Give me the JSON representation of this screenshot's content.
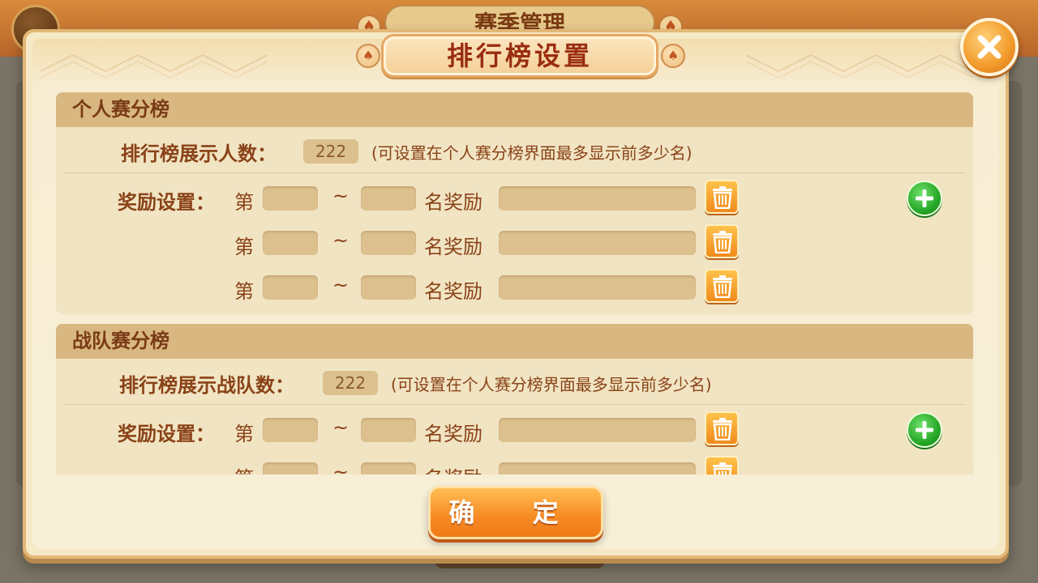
{
  "background": {
    "title": "赛季管理"
  },
  "dialog": {
    "title": "排行榜设置",
    "confirm_label": "确 定"
  },
  "personal": {
    "header": "个人赛分榜",
    "count_label": "排行榜展示人数：",
    "count_value": "222",
    "hint": "(可设置在个人赛分榜界面最多显示前多少名)",
    "reward_label": "奖励设置：",
    "rows": [
      {
        "prefix": "第",
        "tilde": "~",
        "suffix": "名奖励"
      },
      {
        "prefix": "第",
        "tilde": "~",
        "suffix": "名奖励"
      },
      {
        "prefix": "第",
        "tilde": "~",
        "suffix": "名奖励"
      }
    ]
  },
  "team": {
    "header": "战队赛分榜",
    "count_label": "排行榜展示战队数：",
    "count_value": "222",
    "hint": "(可设置在个人赛分榜界面最多显示前多少名)",
    "reward_label": "奖励设置：",
    "rows": [
      {
        "prefix": "第",
        "tilde": "~",
        "suffix": "名奖励"
      },
      {
        "prefix": "第",
        "tilde": "~",
        "suffix": "名奖励"
      }
    ]
  },
  "icons": {
    "close": "close-icon",
    "trash": "trash-icon",
    "add": "plus-icon",
    "spade": "spade-icon"
  },
  "colors": {
    "accent_orange": "#f29a2a",
    "header_brown": "#7a3b17",
    "add_green": "#22a424",
    "title_red": "#9a2d10"
  }
}
